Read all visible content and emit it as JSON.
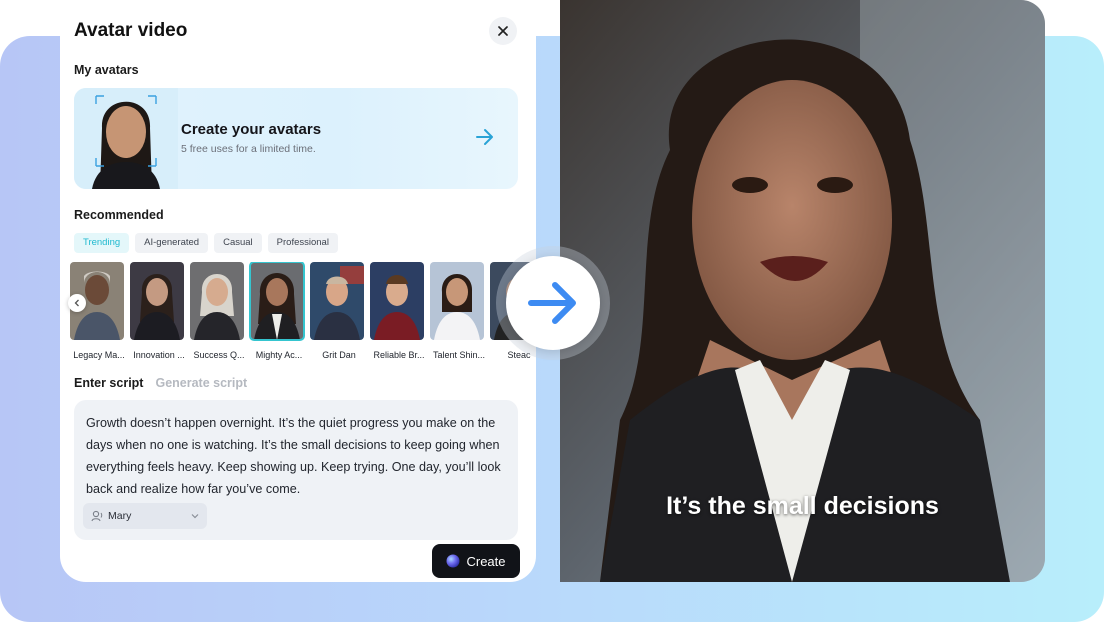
{
  "panel": {
    "title": "Avatar video",
    "close_icon": "close-icon"
  },
  "my_avatars": {
    "label": "My avatars",
    "create_card": {
      "title": "Create your avatars",
      "subtitle": "5 free uses for a limited time.",
      "arrow_icon": "arrow-right-icon"
    }
  },
  "recommended": {
    "label": "Recommended",
    "tabs": [
      {
        "label": "Trending",
        "active": true
      },
      {
        "label": "AI-generated",
        "active": false
      },
      {
        "label": "Casual",
        "active": false
      },
      {
        "label": "Professional",
        "active": false
      }
    ],
    "avatars": [
      {
        "name": "Legacy Ma...",
        "selected": false
      },
      {
        "name": "Innovation ...",
        "selected": false
      },
      {
        "name": "Success Q...",
        "selected": false
      },
      {
        "name": "Mighty Ac...",
        "selected": true
      },
      {
        "name": "Grit Dan",
        "selected": false
      },
      {
        "name": "Reliable Br...",
        "selected": false
      },
      {
        "name": "Talent Shin...",
        "selected": false
      },
      {
        "name": "Steac",
        "selected": false
      }
    ]
  },
  "script": {
    "tabs": [
      {
        "label": "Enter script",
        "active": true
      },
      {
        "label": "Generate script",
        "active": false
      }
    ],
    "text": "Growth doesn’t happen overnight. It’s the quiet progress you make on the days when no one is watching. It’s the small decisions to keep going when everything feels heavy. Keep showing up. Keep trying. One day, you’ll look back and realize how far you’ve come.",
    "voice": "Mary",
    "voice_icon": "voice-icon"
  },
  "create_button": {
    "label": "Create"
  },
  "preview": {
    "caption": "It’s the small decisions"
  },
  "colors": {
    "accent": "#35c5cf",
    "arrow": "#3d8bf2",
    "create_button": "#111318"
  }
}
